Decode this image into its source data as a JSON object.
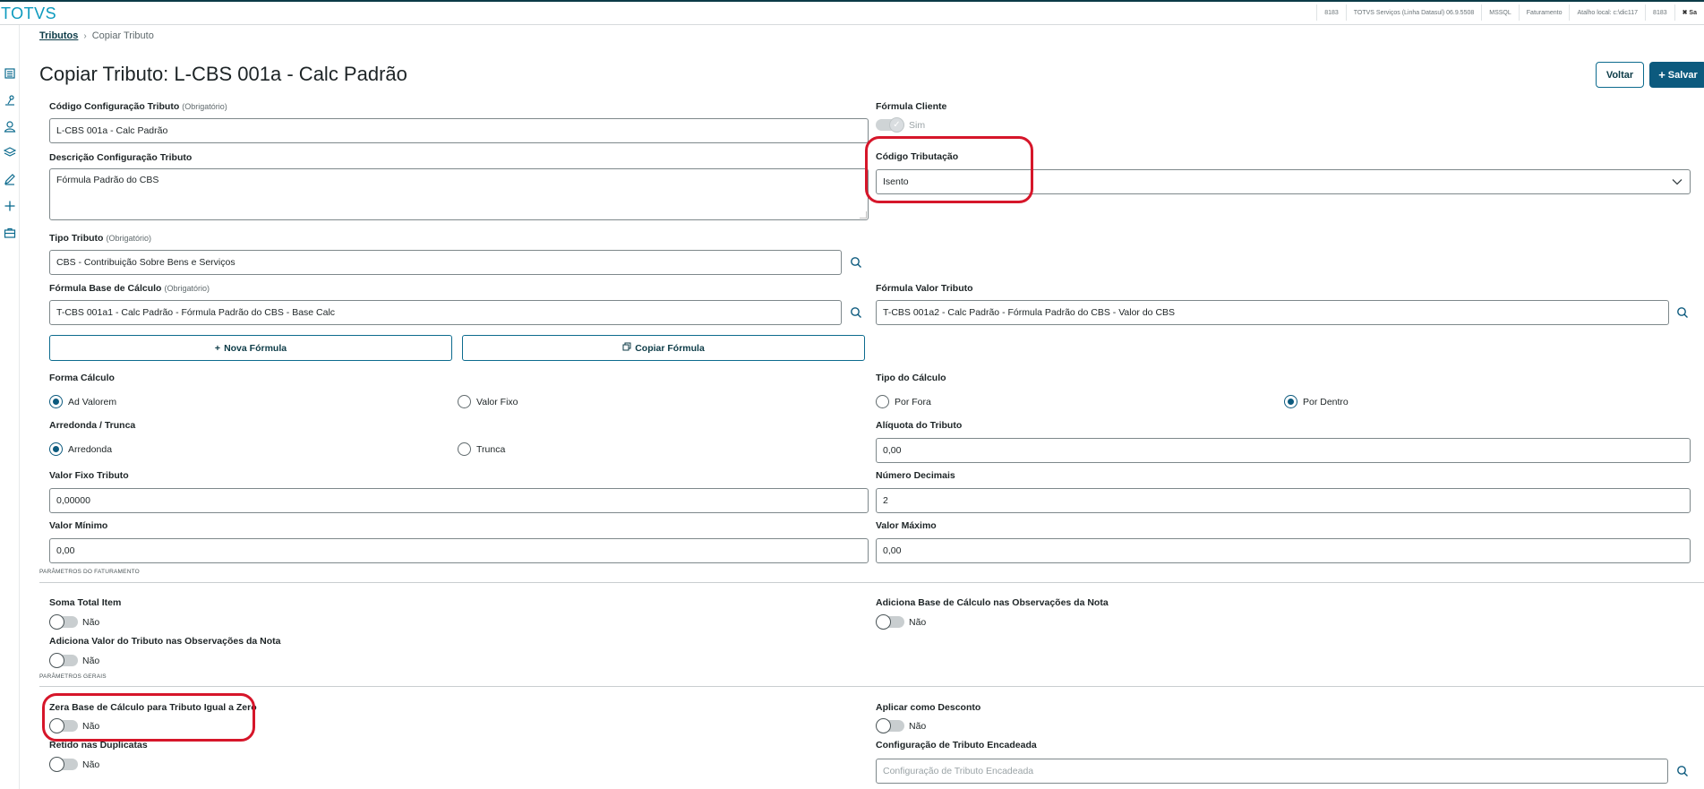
{
  "app": {
    "brand": "TOTVS"
  },
  "status_bar": [
    "8183",
    "TOTVS Serviços (Linha Datasul) 06.9.5508",
    "MSSQL",
    "Faturamento",
    "Atalho local: c:\\dic117",
    "8183",
    "✖ Sa"
  ],
  "rail": [
    "grid-icon",
    "pin-icon",
    "user-icon",
    "layers-icon",
    "edit-icon",
    "plus-icon",
    "briefcase-icon"
  ],
  "breadcrumb": {
    "parent": "Tributos",
    "current": "Copiar Tributo"
  },
  "page": {
    "title": "Copiar Tributo: L-CBS 001a - Calc Padrão"
  },
  "actions": {
    "back": "Voltar",
    "save": "Salvar",
    "save_icon": "+"
  },
  "form": {
    "codigo_config": {
      "label": "Código Configuração Tributo",
      "hint": "(Obrigatório)",
      "value": "L-CBS 001a - Calc Padrão"
    },
    "formula_cliente": {
      "label": "Fórmula Cliente",
      "value": "Sim"
    },
    "descricao": {
      "label": "Descrição Configuração Tributo",
      "value": "Fórmula Padrão do CBS"
    },
    "codigo_tributacao": {
      "label": "Código Tributação",
      "value": "Isento"
    },
    "tipo_tributo": {
      "label": "Tipo Tributo",
      "hint": "(Obrigatório)",
      "value": "CBS - Contribuição Sobre Bens e Serviços"
    },
    "formula_base": {
      "label": "Fórmula Base de Cálculo",
      "hint": "(Obrigatório)",
      "value": "T-CBS 001a1 - Calc Padrão - Fórmula Padrão do CBS - Base Calc"
    },
    "formula_valor": {
      "label": "Fórmula Valor Tributo",
      "value": "T-CBS 001a2 - Calc Padrão - Fórmula Padrão do CBS - Valor do CBS"
    },
    "nova_formula": "Nova Fórmula",
    "copiar_formula": "Copiar Fórmula",
    "forma_calculo": {
      "label": "Forma Cálculo",
      "options": [
        "Ad Valorem",
        "Valor Fixo"
      ],
      "selected": "Ad Valorem"
    },
    "tipo_calculo": {
      "label": "Tipo do Cálculo",
      "options": [
        "Por Fora",
        "Por Dentro"
      ],
      "selected": "Por Dentro"
    },
    "arredonda": {
      "label": "Arredonda / Trunca",
      "options": [
        "Arredonda",
        "Trunca"
      ],
      "selected": "Arredonda"
    },
    "aliquota": {
      "label": "Alíquota do Tributo",
      "value": "0,00"
    },
    "valor_fixo": {
      "label": "Valor Fixo Tributo",
      "value": "0,00000"
    },
    "numero_decimais": {
      "label": "Número Decimais",
      "value": "2"
    },
    "valor_minimo": {
      "label": "Valor Mínimo",
      "value": "0,00"
    },
    "valor_maximo": {
      "label": "Valor Máximo",
      "value": "0,00"
    }
  },
  "faturamento": {
    "section": "PARÂMETROS DO FATURAMENTO",
    "soma_total": {
      "label": "Soma Total Item",
      "value": "Não"
    },
    "adiciona_base": {
      "label": "Adiciona Base de Cálculo nas Observações da Nota",
      "value": "Não"
    },
    "adiciona_valor": {
      "label": "Adiciona Valor do Tributo nas Observações da Nota",
      "value": "Não"
    }
  },
  "gerais": {
    "section": "PARÂMETROS GERAIS",
    "zera_base": {
      "label": "Zera Base de Cálculo para Tributo Igual a Zero",
      "value": "Não"
    },
    "aplicar_desconto": {
      "label": "Aplicar como Desconto",
      "value": "Não"
    },
    "retido": {
      "label": "Retido nas Duplicatas",
      "value": "Não"
    },
    "config_encadeada": {
      "label": "Configuração de Tributo Encadeada",
      "placeholder": "Configuração de Tributo Encadeada"
    }
  },
  "colors": {
    "brand": "#0c9abe",
    "primary": "#0c5a7e",
    "highlight": "#d6162a"
  }
}
